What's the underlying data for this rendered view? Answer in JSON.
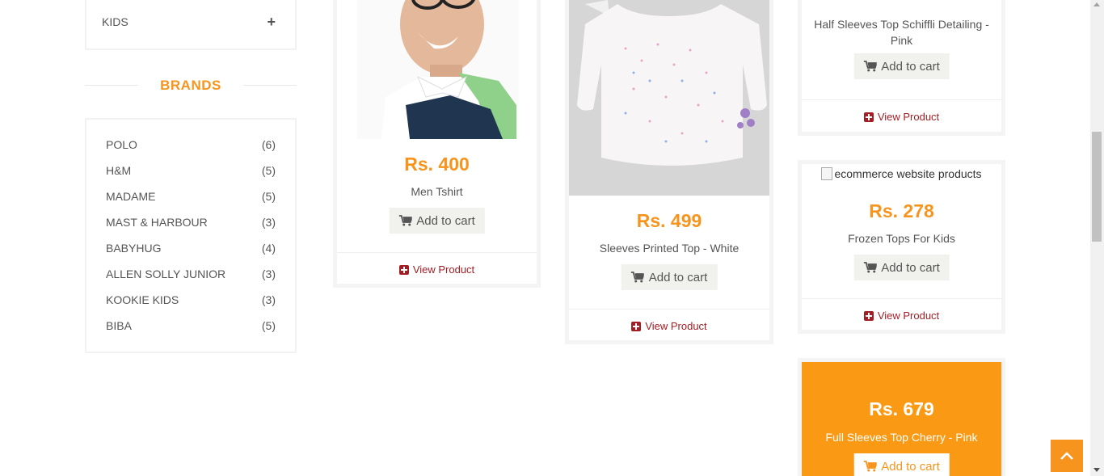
{
  "sidebar": {
    "category_label": "KIDS",
    "brands_title": "BRANDS",
    "brands": [
      {
        "name": "POLO",
        "count": "(6)"
      },
      {
        "name": "H&M",
        "count": "(5)"
      },
      {
        "name": "MADAME",
        "count": "(5)"
      },
      {
        "name": "MAST & HARBOUR",
        "count": "(3)"
      },
      {
        "name": "BABYHUG",
        "count": "(4)"
      },
      {
        "name": "ALLEN SOLLY JUNIOR",
        "count": "(3)"
      },
      {
        "name": "KOOKIE KIDS",
        "count": "(3)"
      },
      {
        "name": "BIBA",
        "count": "(5)"
      }
    ]
  },
  "products": [
    {
      "price": "Rs. 400",
      "name": "Men Tshirt",
      "cart_label": "Add to cart",
      "view_label": "View Product"
    },
    {
      "price": "Rs. 499",
      "name": "Sleeves Printed Top - White",
      "cart_label": "Add to cart",
      "view_label": "View Product"
    },
    {
      "price": "",
      "name": "Half Sleeves Top Schiffli Detailing - Pink",
      "cart_label": "Add to cart",
      "view_label": "View Product"
    },
    {
      "price": "Rs. 278",
      "name": "Frozen Tops For Kids",
      "cart_label": "Add to cart",
      "view_label": "View Product",
      "alt_text": "ecommerce website products"
    },
    {
      "price": "Rs. 679",
      "name": "Full Sleeves Top Cherry - Pink",
      "cart_label": "Add to cart"
    }
  ],
  "colors": {
    "accent": "#f7941d",
    "link": "#a31d24",
    "highlight": "#fa9914"
  },
  "icons": {
    "cart": "shopping-cart-icon",
    "view": "plus-square-icon",
    "expand": "plus-icon",
    "scroll_top": "chevron-up-icon"
  }
}
